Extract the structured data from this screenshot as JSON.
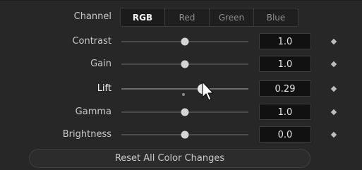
{
  "channel": {
    "label": "Channel",
    "options": [
      "RGB",
      "Red",
      "Green",
      "Blue"
    ],
    "selected": "RGB"
  },
  "rows": [
    {
      "label": "Contrast",
      "value": "1.0",
      "level": 0.5
    },
    {
      "label": "Gain",
      "value": "1.0",
      "level": 0.5
    },
    {
      "label": "Lift",
      "value": "0.29",
      "level": 0.64,
      "active": true
    },
    {
      "label": "Gamma",
      "value": "1.0",
      "level": 0.5
    },
    {
      "label": "Brightness",
      "value": "0.0",
      "level": 0.5
    }
  ],
  "reset_label": "Reset All Color Changes",
  "icons": {
    "keyframe": "keyframe-diamond-icon",
    "cursor": "mouse-pointer-icon"
  },
  "colors": {
    "background": "#272727",
    "field": "#111111",
    "thumb": "#d4d4d4"
  }
}
